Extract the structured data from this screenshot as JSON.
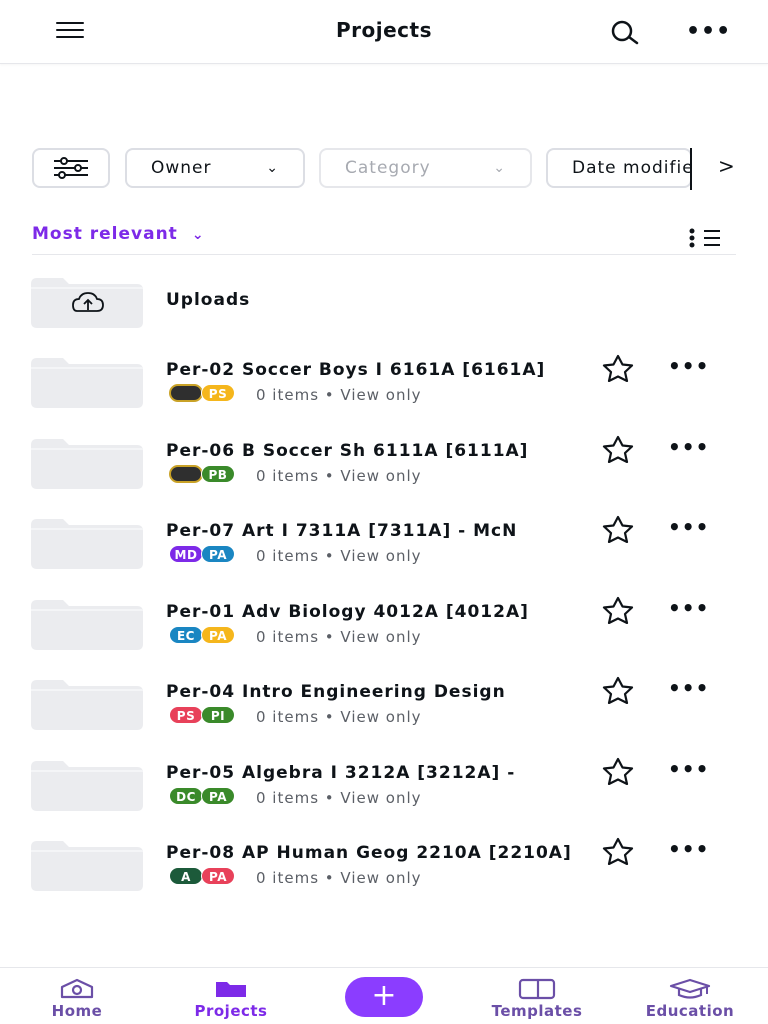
{
  "header": {
    "title": "Projects"
  },
  "filters": {
    "owner": "Owner",
    "category": "Category",
    "date": "Date modified",
    "next": ">"
  },
  "sort": {
    "label": "Most relevant"
  },
  "uploads": {
    "label": "Uploads"
  },
  "folders": [
    {
      "name": "Per-02 Soccer Boys I 6161A [6161A]",
      "meta": "0 items • View only",
      "avatars": [
        "",
        "PS"
      ],
      "colors": [
        "#2f2f2f",
        "#f5b61c"
      ]
    },
    {
      "name": "Per-06 B Soccer Sh 6111A [6111A]",
      "meta": "0 items • View only",
      "avatars": [
        "",
        "PB"
      ],
      "colors": [
        "#2f2f2f",
        "#3a8a2a"
      ]
    },
    {
      "name": "Per-07 Art I 7311A [7311A] - McN",
      "meta": "0 items • View only",
      "avatars": [
        "MD",
        "PA"
      ],
      "colors": [
        "#7d2ae8",
        "#1a86c2"
      ]
    },
    {
      "name": "Per-01 Adv Biology 4012A [4012A]",
      "meta": "0 items • View only",
      "avatars": [
        "EC",
        "PA"
      ],
      "colors": [
        "#1a86c2",
        "#f5b61c"
      ]
    },
    {
      "name": "Per-04 Intro Engineering Design",
      "meta": "0 items • View only",
      "avatars": [
        "PS",
        "PI"
      ],
      "colors": [
        "#e8415a",
        "#3a8a2a"
      ]
    },
    {
      "name": "Per-05 Algebra I 3212A [3212A] -",
      "meta": "0 items • View only",
      "avatars": [
        "DC",
        "PA"
      ],
      "colors": [
        "#3a8a2a",
        "#3a8a2a"
      ]
    },
    {
      "name": "Per-08 AP Human Geog 2210A [2210A]",
      "meta": "0 items • View only",
      "avatars": [
        "A",
        "PA"
      ],
      "colors": [
        "#1c5a3a",
        "#e8415a"
      ]
    }
  ],
  "nav": {
    "home": "Home",
    "projects": "Projects",
    "create": "+",
    "templates": "Templates",
    "education": "Education"
  },
  "colors": {
    "accent": "#7d2ae8",
    "fab": "#8b3dff"
  }
}
